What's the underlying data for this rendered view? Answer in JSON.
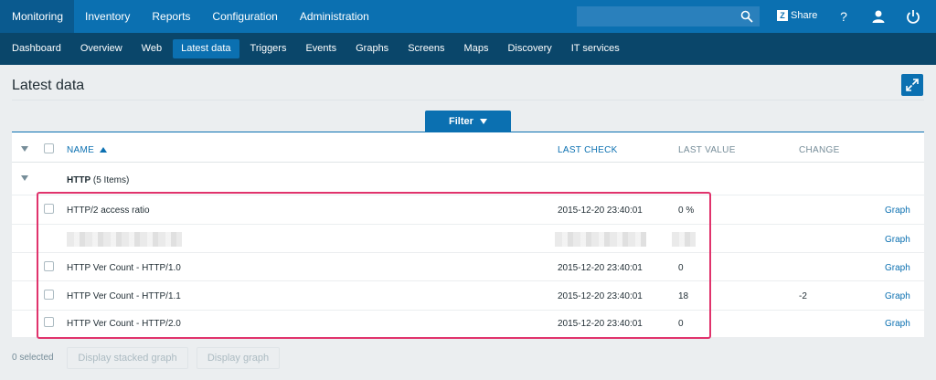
{
  "topnav": {
    "menu": [
      "Monitoring",
      "Inventory",
      "Reports",
      "Configuration",
      "Administration"
    ],
    "share_label": "Share",
    "share_logo": "Z",
    "help_label": "?"
  },
  "subnav": {
    "items": [
      "Dashboard",
      "Overview",
      "Web",
      "Latest data",
      "Triggers",
      "Events",
      "Graphs",
      "Screens",
      "Maps",
      "Discovery",
      "IT services"
    ],
    "active": "Latest data"
  },
  "page": {
    "title": "Latest data",
    "filter_label": "Filter"
  },
  "table": {
    "columns": {
      "name": "NAME",
      "last_check": "LAST CHECK",
      "last_value": "LAST VALUE",
      "change": "CHANGE"
    },
    "group": {
      "name": "HTTP",
      "count": "(5 Items)"
    },
    "rows": [
      {
        "name": "HTTP/2 access ratio",
        "last_check": "2015-12-20 23:40:01",
        "last_value": "0 %",
        "change": "",
        "link": "Graph"
      },
      {
        "name": "",
        "last_check": "",
        "last_value": "",
        "change": "",
        "link": "Graph"
      },
      {
        "name": "HTTP Ver Count - HTTP/1.0",
        "last_check": "2015-12-20 23:40:01",
        "last_value": "0",
        "change": "",
        "link": "Graph"
      },
      {
        "name": "HTTP Ver Count - HTTP/1.1",
        "last_check": "2015-12-20 23:40:01",
        "last_value": "18",
        "change": "-2",
        "link": "Graph"
      },
      {
        "name": "HTTP Ver Count - HTTP/2.0",
        "last_check": "2015-12-20 23:40:01",
        "last_value": "0",
        "change": "",
        "link": "Graph"
      }
    ]
  },
  "footer": {
    "selected_text": "0 selected",
    "stacked_button": "Display stacked graph",
    "graph_button": "Display graph"
  },
  "colors": {
    "primary": "#0b70b1",
    "dark_nav": "#0a466a",
    "highlight": "#e0336c"
  }
}
